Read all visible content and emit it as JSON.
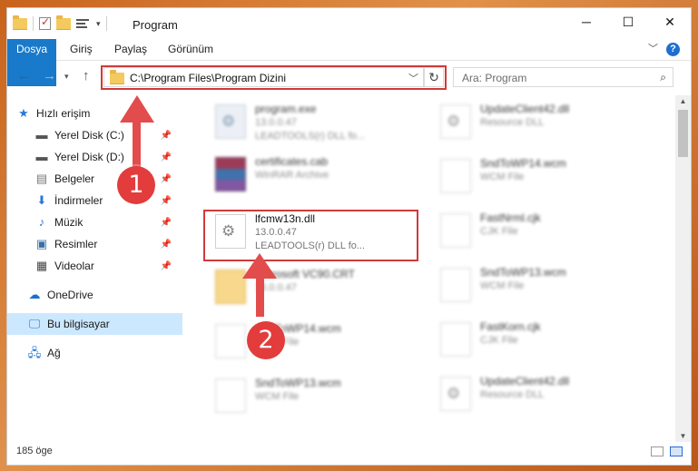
{
  "window": {
    "title": "Program",
    "controls": {
      "minimize": "─",
      "maximize": "☐",
      "close": "✕"
    }
  },
  "ribbon": {
    "tabs": [
      "Dosya",
      "Giriş",
      "Paylaş",
      "Görünüm"
    ],
    "help": "?"
  },
  "address": {
    "path": "C:\\Program Files\\Program Dizini",
    "search_placeholder": "Ara: Program"
  },
  "sidebar": {
    "items": [
      {
        "label": "Hızlı erişim",
        "icon": "star-icon"
      },
      {
        "label": "Yerel Disk (C:)",
        "icon": "drive-icon"
      },
      {
        "label": "Yerel Disk (D:)",
        "icon": "drive-icon"
      },
      {
        "label": "Belgeler",
        "icon": "document-icon"
      },
      {
        "label": "İndirmeler",
        "icon": "download-icon"
      },
      {
        "label": "Müzik",
        "icon": "music-icon"
      },
      {
        "label": "Resimler",
        "icon": "pictures-icon"
      },
      {
        "label": "Videolar",
        "icon": "video-icon"
      },
      {
        "label": "OneDrive",
        "icon": "cloud-icon"
      },
      {
        "label": "Bu bilgisayar",
        "icon": "computer-icon"
      },
      {
        "label": "Ağ",
        "icon": "network-icon"
      }
    ]
  },
  "files": {
    "left": [
      {
        "name": "program.exe",
        "line1": "13.0.0.47",
        "line2": "LEADTOOLS(r) DLL fo..."
      },
      {
        "name": "certificates.cab",
        "line1": "WinRAR Archive",
        "line2": ""
      },
      {
        "name": "lfcmw13n.dll",
        "line1": "13.0.0.47",
        "line2": "LEADTOOLS(r) DLL fo..."
      },
      {
        "name": "Microsoft VC90.CRT",
        "line1": "13.0.0.47",
        "line2": ""
      },
      {
        "name": "SndToWP14.wcm",
        "line1": "WCM File",
        "line2": ""
      },
      {
        "name": "SndToWP13.wcm",
        "line1": "WCM File",
        "line2": ""
      }
    ],
    "right": [
      {
        "name": "UpdateClient42.dll",
        "line1": "Resource DLL"
      },
      {
        "name": "SndToWP14.wcm",
        "line1": "WCM File"
      },
      {
        "name": "FastNrml.cjk",
        "line1": "CJK File"
      },
      {
        "name": "SndToWP13.wcm",
        "line1": "WCM File"
      },
      {
        "name": "FastKorn.cjk",
        "line1": "CJK File"
      },
      {
        "name": "UpdateClient42.dll",
        "line1": "Resource DLL"
      }
    ]
  },
  "status": {
    "count": "185 öge"
  },
  "annotations": {
    "step1": "1",
    "step2": "2",
    "color": "#e23c3c"
  }
}
